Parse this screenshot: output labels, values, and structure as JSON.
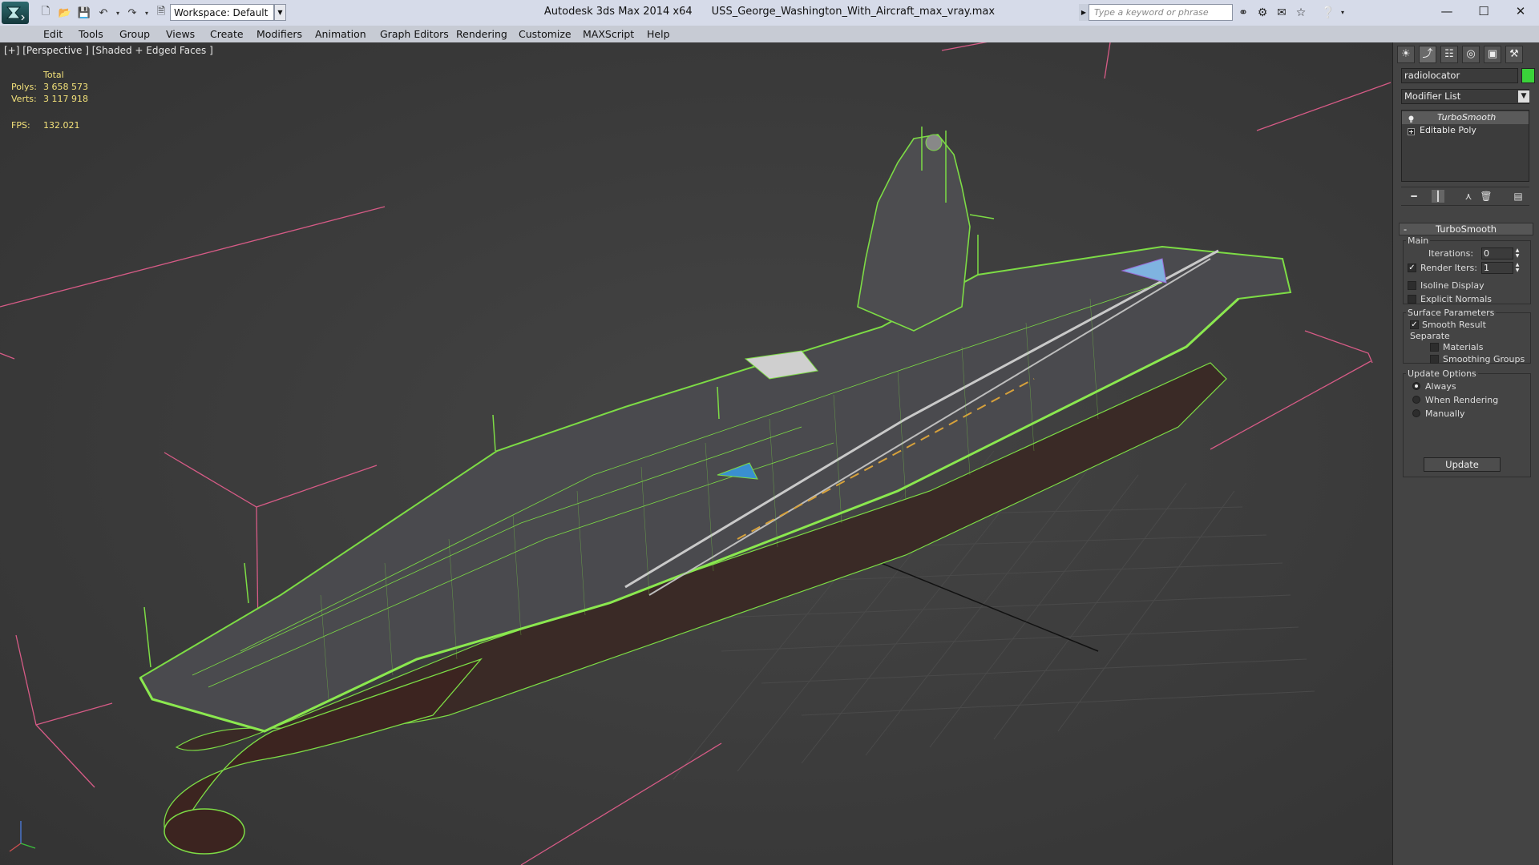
{
  "titlebar": {
    "app_name": "Autodesk 3ds Max  2014 x64",
    "file_name": "USS_George_Washington_With_Aircraft_max_vray.max",
    "workspace": "Workspace: Default",
    "search_placeholder": "Type a keyword or phrase",
    "window_controls": {
      "minimize": "—",
      "maximize": "☐",
      "close": "✕"
    }
  },
  "menu": [
    "Edit",
    "Tools",
    "Group",
    "Views",
    "Create",
    "Modifiers",
    "Animation",
    "Graph Editors",
    "Rendering",
    "Customize",
    "MAXScript",
    "Help"
  ],
  "viewport": {
    "label": "[+] [Perspective ] [Shaded + Edged Faces ]",
    "stats": {
      "total_label": "Total",
      "polys_label": "Polys:",
      "polys_value": "3 658 573",
      "verts_label": "Verts:",
      "verts_value": "3 117 918",
      "fps_label": "FPS:",
      "fps_value": "132.021"
    },
    "wire_color": "#7ddc45",
    "bounds_color": "#d65b86"
  },
  "command_panel": {
    "tabs": [
      "create-icon",
      "modify-icon",
      "hierarchy-icon",
      "motion-icon",
      "display-icon",
      "utilities-icon"
    ],
    "object_name": "radiolocator",
    "object_color": "#3ad33a",
    "modifier_list": "Modifier List",
    "stack": [
      "TurboSmooth",
      "Editable Poly"
    ],
    "rollout_title": "TurboSmooth",
    "main_group": "Main",
    "iterations_label": "Iterations:",
    "iterations_value": "0",
    "render_iters_label": "Render Iters:",
    "render_iters_value": "1",
    "isoline_label": "Isoline Display",
    "explicit_normals_label": "Explicit Normals",
    "surface_group": "Surface Parameters",
    "smooth_result_label": "Smooth Result",
    "separate_label": "Separate",
    "materials_label": "Materials",
    "smoothing_groups_label": "Smoothing Groups",
    "update_group": "Update Options",
    "always_label": "Always",
    "when_rendering_label": "When Rendering",
    "manually_label": "Manually",
    "update_button": "Update"
  }
}
